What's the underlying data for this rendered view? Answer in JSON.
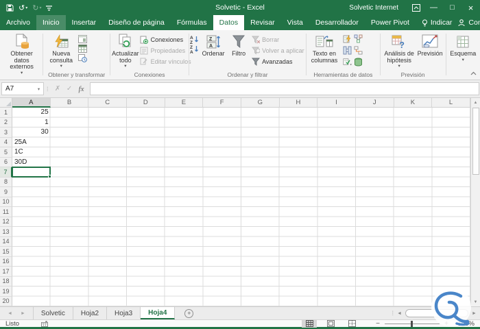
{
  "titlebar": {
    "title": "Solvetic - Excel",
    "user": "Solvetic Internet"
  },
  "icons": {
    "caret": "▾",
    "undo": "↺",
    "redo": "↻",
    "win_min": "—",
    "win_max": "□",
    "win_close": "×",
    "cancel": "✗",
    "confirm": "✓",
    "function": "fx",
    "dots": "⁞",
    "nav_left": "◄",
    "nav_right": "►",
    "scroll_up": "▲",
    "scroll_down": "▼",
    "add_sheet": "+",
    "minus": "−",
    "plus": "+",
    "collapse": "ˆ"
  },
  "menu": {
    "tabs": [
      "Archivo",
      "Inicio",
      "Insertar",
      "Diseño de página",
      "Fórmulas",
      "Datos",
      "Revisar",
      "Vista",
      "Desarrollador",
      "Power Pivot",
      "Indicar"
    ],
    "active_tab": "Datos",
    "highlighted_tab": "Inicio",
    "share": "Compartir"
  },
  "ribbon": {
    "buttons": {
      "get_external_data": "Obtener datos externos",
      "new_query": "Nueva consulta",
      "refresh_all": "Actualizar todo",
      "connections": "Conexiones",
      "properties": "Propiedades",
      "edit_links": "Editar vínculos",
      "sort": "Ordenar",
      "filter": "Filtro",
      "clear": "Borrar",
      "reapply": "Volver a aplicar",
      "advanced": "Avanzadas",
      "text_to_columns": "Texto en columnas",
      "what_if": "Análisis de hipótesis",
      "forecast": "Previsión",
      "outline": "Esquema"
    },
    "group_labels": {
      "get_transform": "Obtener y transformar",
      "connections": "Conexiones",
      "sort_filter": "Ordenar y filtrar",
      "data_tools": "Herramientas de datos",
      "forecast": "Previsión"
    }
  },
  "formula_bar": {
    "cell_reference": "A7",
    "formula_value": ""
  },
  "grid": {
    "column_headers": [
      "A",
      "B",
      "C",
      "D",
      "E",
      "F",
      "G",
      "H",
      "I",
      "J",
      "K",
      "L"
    ],
    "row_count": 21,
    "cells": [
      {
        "ref": "A1",
        "row": 1,
        "col": "A",
        "value": "25",
        "align": "right"
      },
      {
        "ref": "A2",
        "row": 2,
        "col": "A",
        "value": "1",
        "align": "right"
      },
      {
        "ref": "A3",
        "row": 3,
        "col": "A",
        "value": "30",
        "align": "right"
      },
      {
        "ref": "A4",
        "row": 4,
        "col": "A",
        "value": "25A",
        "align": "left"
      },
      {
        "ref": "A5",
        "row": 5,
        "col": "A",
        "value": "1C",
        "align": "left"
      },
      {
        "ref": "A6",
        "row": 6,
        "col": "A",
        "value": "30D",
        "align": "left"
      }
    ],
    "selected_cell": {
      "ref": "A7",
      "column": "A",
      "row": 7
    }
  },
  "sheet_bar": {
    "tabs": [
      "Solvetic",
      "Hoja2",
      "Hoja3",
      "Hoja4"
    ],
    "active_tab": "Hoja4"
  },
  "status_bar": {
    "mode": "Listo",
    "zoom_level": "100%"
  }
}
